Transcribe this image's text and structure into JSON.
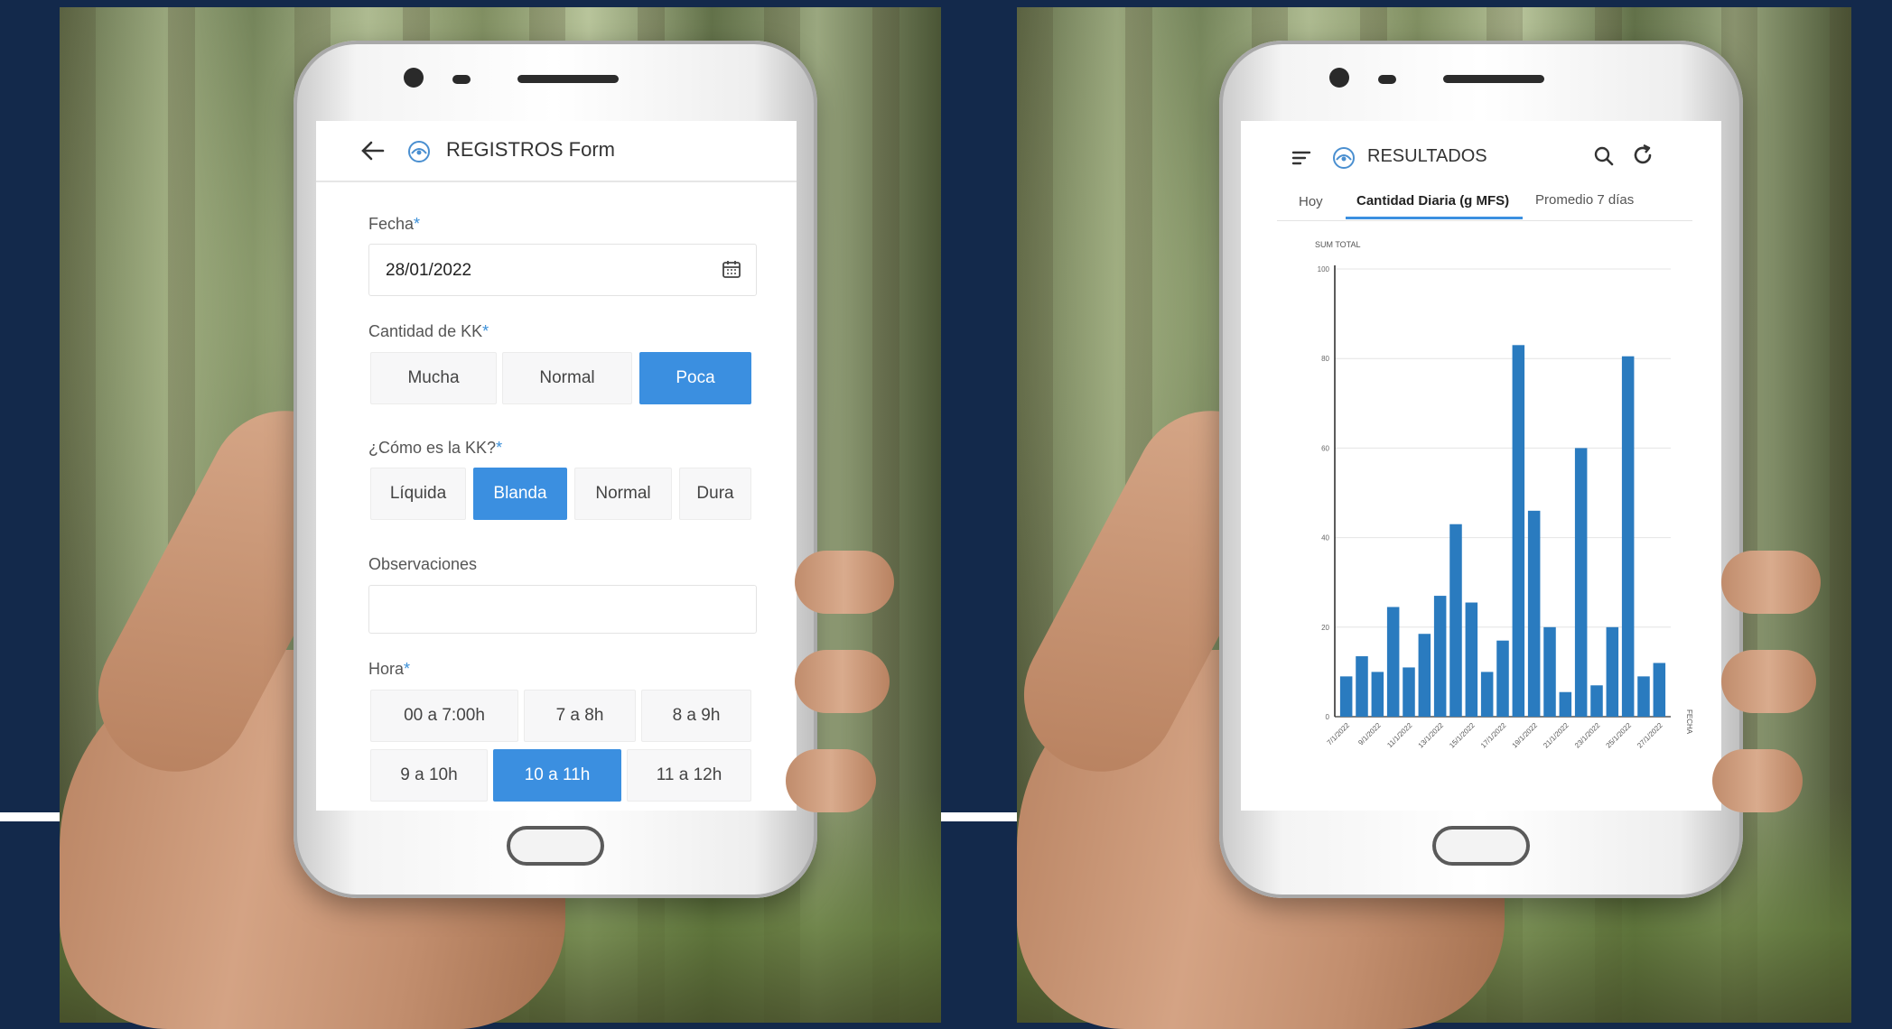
{
  "form": {
    "title": "REGISTROS Form",
    "fecha_label": "Fecha",
    "fecha_value": "28/01/2022",
    "cantidad_label": "Cantidad de KK",
    "cantidad_options": [
      "Mucha",
      "Normal",
      "Poca"
    ],
    "cantidad_selected": "Poca",
    "como_label": "¿Cómo es la KK?",
    "como_options": [
      "Líquida",
      "Blanda",
      "Normal",
      "Dura"
    ],
    "como_selected": "Blanda",
    "observaciones_label": "Observaciones",
    "observaciones_value": "",
    "hora_label": "Hora",
    "hora_options": [
      "00 a 7:00h",
      "7 a 8h",
      "8 a 9h",
      "9 a 10h",
      "10 a 11h",
      "11 a 12h"
    ],
    "hora_selected": "10 a 11h",
    "required_mark": "*"
  },
  "results": {
    "title": "RESULTADOS",
    "tabs": [
      "Hoy",
      "Cantidad Diaria (g MFS)",
      "Promedio 7 días"
    ],
    "active_tab": "Cantidad Diaria (g MFS)"
  },
  "chart_data": {
    "type": "bar",
    "ylabel": "SUM TOTAL",
    "xlabel": "FECHA",
    "ylim": [
      0,
      100
    ],
    "yticks": [
      0,
      20,
      40,
      60,
      80,
      100
    ],
    "grid": true,
    "categories": [
      "7/1/2022",
      "8/1/2022",
      "9/1/2022",
      "10/1/2022",
      "11/1/2022",
      "12/1/2022",
      "13/1/2022",
      "14/1/2022",
      "15/1/2022",
      "16/1/2022",
      "17/1/2022",
      "18/1/2022",
      "19/1/2022",
      "20/1/2022",
      "21/1/2022",
      "22/1/2022",
      "23/1/2022",
      "24/1/2022",
      "25/1/2022",
      "26/1/2022",
      "27/1/2022"
    ],
    "tick_labels": [
      "7/1/2022",
      "9/1/2022",
      "11/1/2022",
      "13/1/2022",
      "15/1/2022",
      "17/1/2022",
      "19/1/2022",
      "21/1/2022",
      "23/1/2022",
      "25/1/2022",
      "27/1/2022"
    ],
    "values": [
      9,
      13.5,
      10,
      24.5,
      11,
      18.5,
      27,
      43,
      25.5,
      10,
      17,
      83,
      46,
      20,
      5.5,
      60,
      7,
      20,
      80.5,
      9,
      12
    ],
    "color": "#2a7bbf"
  }
}
